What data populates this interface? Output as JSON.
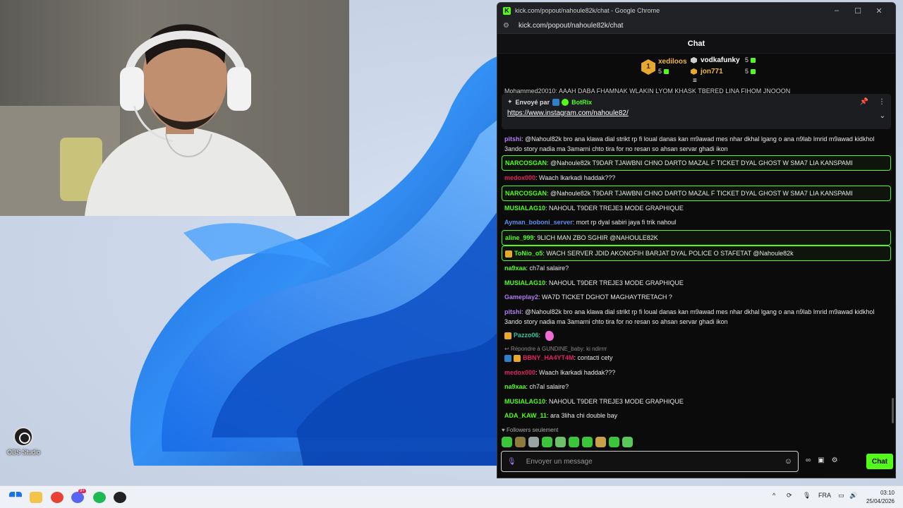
{
  "window": {
    "title": "kick.com/popout/nahoule82k/chat - Google Chrome",
    "url": "kick.com/popout/nahoule82k/chat"
  },
  "chat": {
    "header": "Chat",
    "leaderboard": [
      {
        "rank": "1",
        "name": "xediloos",
        "count": "5",
        "color": "#f0b93a"
      },
      {
        "name": "vodkafunky",
        "count": "5",
        "color": "#ffffff"
      },
      {
        "name": "jon771",
        "count": "5",
        "color": "#f0b93a"
      }
    ],
    "cut_message": "Mohammed20010: AAAH DABA FHAMNAK WLAKIN LYOM KHASK TBERED LINA FIHOM JNOOON",
    "pinned": {
      "sent_by_label": "Envoyé par",
      "sender": "BotRix",
      "link": "https://www.instagram.com/nahoule82/"
    },
    "messages": [
      {
        "user": "pitshi",
        "color": "#b07af0",
        "text": "@Nahoul82k bro ana klawa dial strikt rp fi loual danas kan m9awad mes nhar dkhal lgang o ana n9lab lmrid m9awad kidkhol 3ando story nadia ma 3amarni chto tira for no resan so ahsan servar ghadi ikon"
      },
      {
        "user": "NARCOSGAN",
        "color": "#53fc18",
        "text": "@Nahoule82k T9DAR TJAWBNI CHNO DARTO MAZAL F TICKET DYAL GHOST W SMA7 LIA KANSPAMI"
      },
      {
        "user": "medox000",
        "color": "#e0245e",
        "text": "Waach lkarkadi haddak???"
      },
      {
        "user": "NARCOSGAN",
        "color": "#53fc18",
        "text": "@Nahoule82k T9DAR TJAWBNI CHNO DARTO MAZAL F TICKET DYAL GHOST W SMA7 LIA KANSPAMI"
      },
      {
        "user": "MUSIALAG10",
        "color": "#53fc18",
        "text": "NAHOUL T9DER TREJE3 MODE GRAPHIQUE"
      },
      {
        "user": "Ayman_boboni_server",
        "color": "#5b8def",
        "text": "mort rp dyal sabiri jaya fi trik nahoul"
      },
      {
        "user": "aline_999",
        "color": "#53fc18",
        "text": "9LICH MAN ZBO SGHIR @NAHOULE82K"
      },
      {
        "user": "ToNio_o5",
        "color": "#53fc18",
        "text": "WACH SERVER JDID AKONOFIH BARJAT DYAL POLICE O STAFETAT @Nahoule82k"
      },
      {
        "user": "na9xaa",
        "color": "#53fc18",
        "text": "ch7al salaire?"
      },
      {
        "user": "MUSIALAG10",
        "color": "#53fc18",
        "text": "NAHOUL T9DER TREJE3 MODE GRAPHIQUE"
      },
      {
        "user": "Gameplay2",
        "color": "#b07af0",
        "text": "WA7D TICKET DGHOT MAGHAYTRETACH ?"
      },
      {
        "user": "pitshi",
        "color": "#b07af0",
        "text": "@Nahoul82k bro ana klawa dial strikt rp fi loual danas kan m9awad mes nhar dkhal lgang o ana n9lab lmrid m9awad kidkhol 3ando story nadia ma 3amarni chto tira for no resan so ahsan servar ghadi ikon"
      },
      {
        "user": "Pazzo06",
        "color": "#2fc4a0",
        "text": ""
      },
      {
        "user": "BBNY_HA4YT4M",
        "color": "#e0245e",
        "text": "contacti cety"
      },
      {
        "user": "medox000",
        "color": "#e0245e",
        "text": "Waach lkarkadi haddak???"
      },
      {
        "user": "na9xaa",
        "color": "#53fc18",
        "text": "ch7al salaire?"
      },
      {
        "user": "MUSIALAG10",
        "color": "#53fc18",
        "text": "NAHOUL T9DER TREJE3 MODE GRAPHIQUE"
      },
      {
        "user": "ADA_KAW_11",
        "color": "#53fc18",
        "text": "ara 3liha chi double bay"
      }
    ],
    "reply_line": "Répondre à GUNDINE_baby: ki ndirrrr",
    "followers_only": "Followers seulement",
    "input_placeholder": "Envoyer un message",
    "send_label": "Chat"
  },
  "desktop": {
    "obs_label": "OBS Studio"
  },
  "taskbar": {
    "language": "FRA",
    "time": "03:10",
    "date": "25/04/2026",
    "discord_badge": "9+"
  }
}
